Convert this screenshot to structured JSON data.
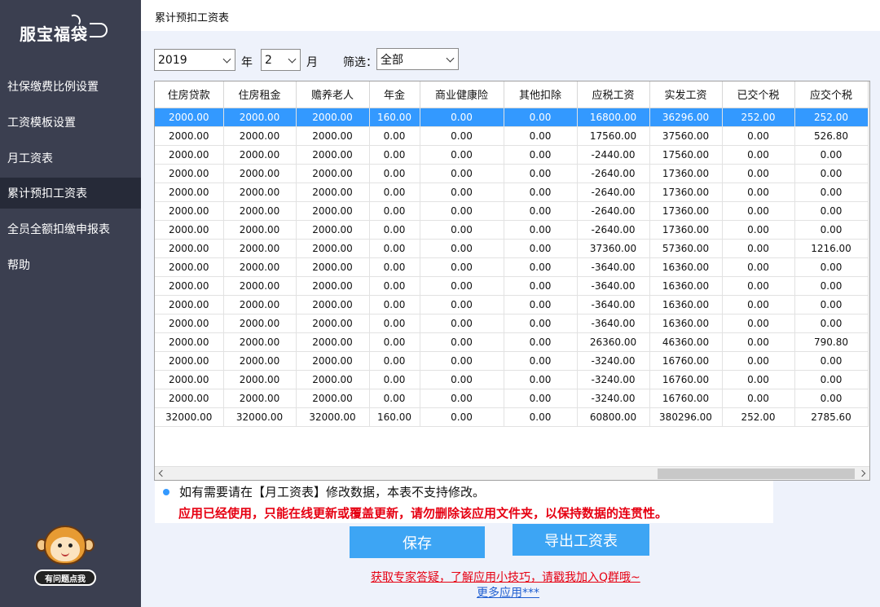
{
  "sidebar": {
    "logo_text": "服宝福袋",
    "items": [
      {
        "label": "社保缴费比例设置",
        "active": false
      },
      {
        "label": "工资模板设置",
        "active": false
      },
      {
        "label": "月工资表",
        "active": false
      },
      {
        "label": "累计预扣工资表",
        "active": true
      },
      {
        "label": "全员全额扣缴申报表",
        "active": false
      },
      {
        "label": "帮助",
        "active": false
      }
    ],
    "help_badge": "有问题点我"
  },
  "header": {
    "title": "累计预扣工资表"
  },
  "filters": {
    "year_value": "2019",
    "year_label": "年",
    "month_value": "2",
    "month_label": "月",
    "filter_label": "筛选：",
    "filter_value": "全部"
  },
  "table": {
    "columns": [
      "住房贷款",
      "住房租金",
      "赡养老人",
      "年金",
      "商业健康险",
      "其他扣除",
      "应税工资",
      "实发工资",
      "已交个税",
      "应交个税"
    ],
    "selected_row": 0,
    "rows": [
      [
        "2000.00",
        "2000.00",
        "2000.00",
        "160.00",
        "0.00",
        "0.00",
        "16800.00",
        "36296.00",
        "252.00",
        "252.00"
      ],
      [
        "2000.00",
        "2000.00",
        "2000.00",
        "0.00",
        "0.00",
        "0.00",
        "17560.00",
        "37560.00",
        "0.00",
        "526.80"
      ],
      [
        "2000.00",
        "2000.00",
        "2000.00",
        "0.00",
        "0.00",
        "0.00",
        "-2440.00",
        "17560.00",
        "0.00",
        "0.00"
      ],
      [
        "2000.00",
        "2000.00",
        "2000.00",
        "0.00",
        "0.00",
        "0.00",
        "-2640.00",
        "17360.00",
        "0.00",
        "0.00"
      ],
      [
        "2000.00",
        "2000.00",
        "2000.00",
        "0.00",
        "0.00",
        "0.00",
        "-2640.00",
        "17360.00",
        "0.00",
        "0.00"
      ],
      [
        "2000.00",
        "2000.00",
        "2000.00",
        "0.00",
        "0.00",
        "0.00",
        "-2640.00",
        "17360.00",
        "0.00",
        "0.00"
      ],
      [
        "2000.00",
        "2000.00",
        "2000.00",
        "0.00",
        "0.00",
        "0.00",
        "-2640.00",
        "17360.00",
        "0.00",
        "0.00"
      ],
      [
        "2000.00",
        "2000.00",
        "2000.00",
        "0.00",
        "0.00",
        "0.00",
        "37360.00",
        "57360.00",
        "0.00",
        "1216.00"
      ],
      [
        "2000.00",
        "2000.00",
        "2000.00",
        "0.00",
        "0.00",
        "0.00",
        "-3640.00",
        "16360.00",
        "0.00",
        "0.00"
      ],
      [
        "2000.00",
        "2000.00",
        "2000.00",
        "0.00",
        "0.00",
        "0.00",
        "-3640.00",
        "16360.00",
        "0.00",
        "0.00"
      ],
      [
        "2000.00",
        "2000.00",
        "2000.00",
        "0.00",
        "0.00",
        "0.00",
        "-3640.00",
        "16360.00",
        "0.00",
        "0.00"
      ],
      [
        "2000.00",
        "2000.00",
        "2000.00",
        "0.00",
        "0.00",
        "0.00",
        "-3640.00",
        "16360.00",
        "0.00",
        "0.00"
      ],
      [
        "2000.00",
        "2000.00",
        "2000.00",
        "0.00",
        "0.00",
        "0.00",
        "26360.00",
        "46360.00",
        "0.00",
        "790.80"
      ],
      [
        "2000.00",
        "2000.00",
        "2000.00",
        "0.00",
        "0.00",
        "0.00",
        "-3240.00",
        "16760.00",
        "0.00",
        "0.00"
      ],
      [
        "2000.00",
        "2000.00",
        "2000.00",
        "0.00",
        "0.00",
        "0.00",
        "-3240.00",
        "16760.00",
        "0.00",
        "0.00"
      ],
      [
        "2000.00",
        "2000.00",
        "2000.00",
        "0.00",
        "0.00",
        "0.00",
        "-3240.00",
        "16760.00",
        "0.00",
        "0.00"
      ],
      [
        "32000.00",
        "32000.00",
        "32000.00",
        "160.00",
        "0.00",
        "0.00",
        "60800.00",
        "380296.00",
        "252.00",
        "2785.60"
      ]
    ]
  },
  "notice": {
    "line1": "如有需要请在【月工资表】修改数据，本表不支持修改。",
    "line2": "应用已经使用，只能在线更新或覆盖更新，请勿删除该应用文件夹，以保持数据的连贯性。"
  },
  "buttons": {
    "save": "保存",
    "export": "导出工资表"
  },
  "links": {
    "expert": "获取专家答疑，了解应用小技巧，请戳我加入Q群哦~",
    "more": "更多应用***"
  },
  "colors": {
    "sidebar_bg": "#3b3f50",
    "selected_row": "#3399ff",
    "button": "#3da5f4",
    "warning": "#e60012",
    "link": "#e60012",
    "more_link": "#1f5fd1"
  }
}
